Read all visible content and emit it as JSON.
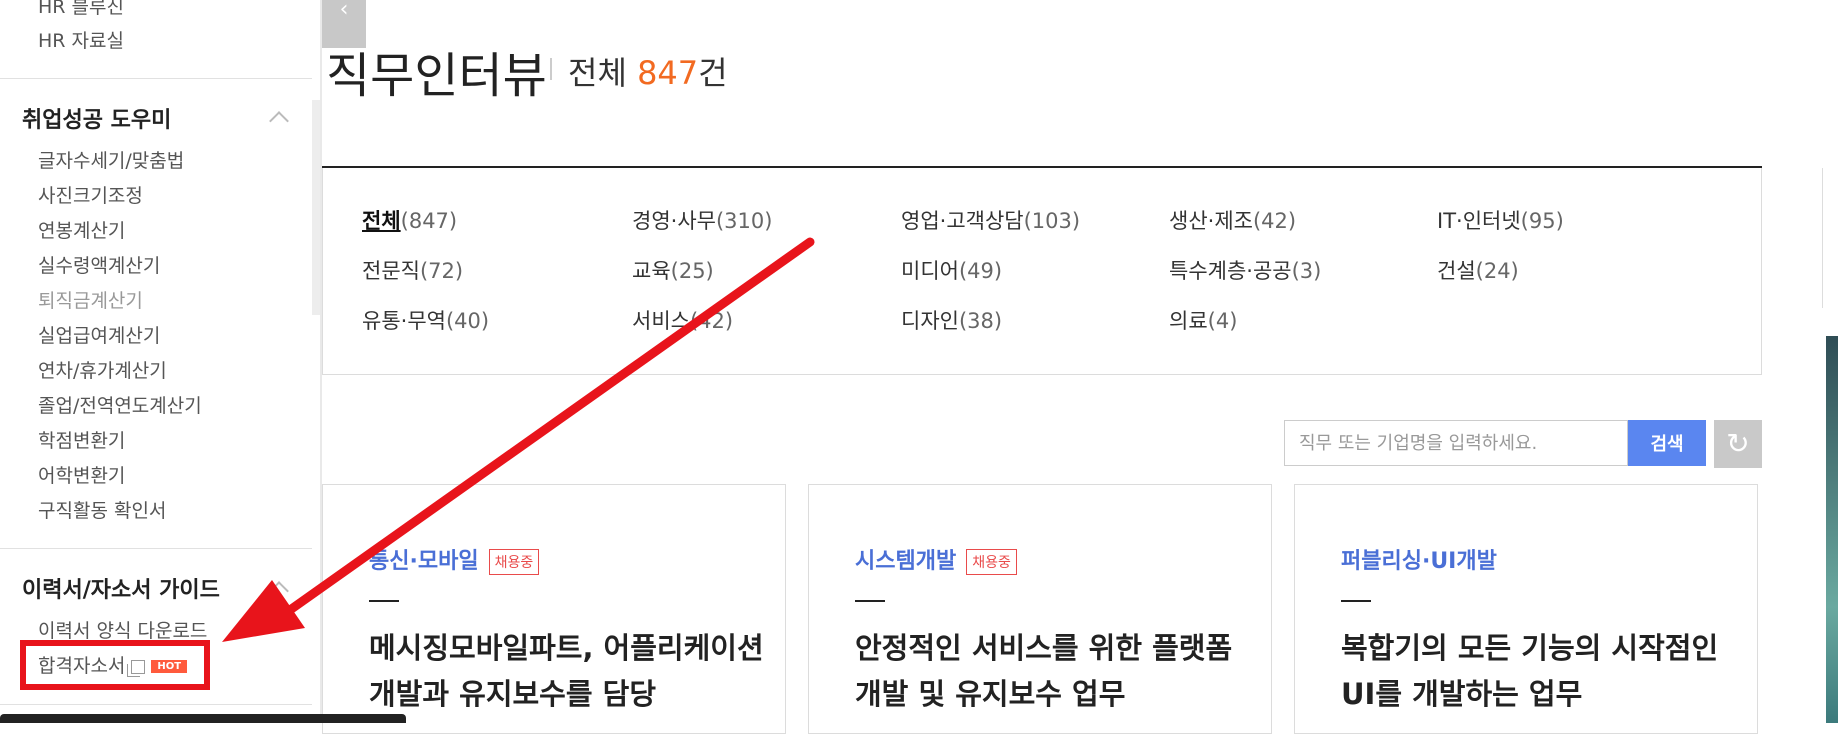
{
  "sidebar": {
    "top_links": [
      "HR 블루진",
      "HR 자료실"
    ],
    "section1": {
      "title": "취업성공 도우미",
      "items": [
        "글자수세기/맞춤법",
        "사진크기조정",
        "연봉계산기",
        "실수령액계산기",
        "퇴직금계산기",
        "실업급여계산기",
        "연차/휴가계산기",
        "졸업/전역연도계산기",
        "학점변환기",
        "어학변환기",
        "구직활동 확인서"
      ]
    },
    "section2": {
      "title": "이력서/자소서 가이드",
      "items": [
        "이력서 양식 다운로드",
        "합격자소서"
      ],
      "hot_badge": "HOT"
    },
    "collapse_icon": "chevron-left-icon"
  },
  "page": {
    "title": "직무인터뷰",
    "count_prefix": "전체 ",
    "count_value": "847",
    "count_suffix": "건"
  },
  "categories": [
    {
      "label": "전체",
      "count": "(847)",
      "active": true
    },
    {
      "label": "경영·사무",
      "count": "(310)"
    },
    {
      "label": "영업·고객상담",
      "count": "(103)"
    },
    {
      "label": "생산·제조",
      "count": "(42)"
    },
    {
      "label": "IT·인터넷",
      "count": "(95)"
    },
    {
      "label": "전문직",
      "count": "(72)"
    },
    {
      "label": "교육",
      "count": "(25)"
    },
    {
      "label": "미디어",
      "count": "(49)"
    },
    {
      "label": "특수계층·공공",
      "count": "(3)"
    },
    {
      "label": "건설",
      "count": "(24)"
    },
    {
      "label": "유통·무역",
      "count": "(40)"
    },
    {
      "label": "서비스",
      "count": "(42)"
    },
    {
      "label": "디자인",
      "count": "(38)"
    },
    {
      "label": "의료",
      "count": "(4)"
    }
  ],
  "search": {
    "placeholder": "직무 또는 기업명을 입력하세요.",
    "button_label": "검색",
    "reset_icon": "refresh-icon"
  },
  "cards": [
    {
      "category": "통신·모바일",
      "badge": "채용중",
      "title": "메시징모바일파트, 어플리케이션 개발과 유지보수를 담당"
    },
    {
      "category": "시스템개발",
      "badge": "채용중",
      "title": "안정적인 서비스를 위한 플랫폼 개발 및 유지보수 업무"
    },
    {
      "category": "퍼블리싱·UI개발",
      "badge": "",
      "title": "복합기의 모든 기능의 시작점인 UI를 개발하는 업무"
    }
  ],
  "annotation_color": "#e8141b"
}
